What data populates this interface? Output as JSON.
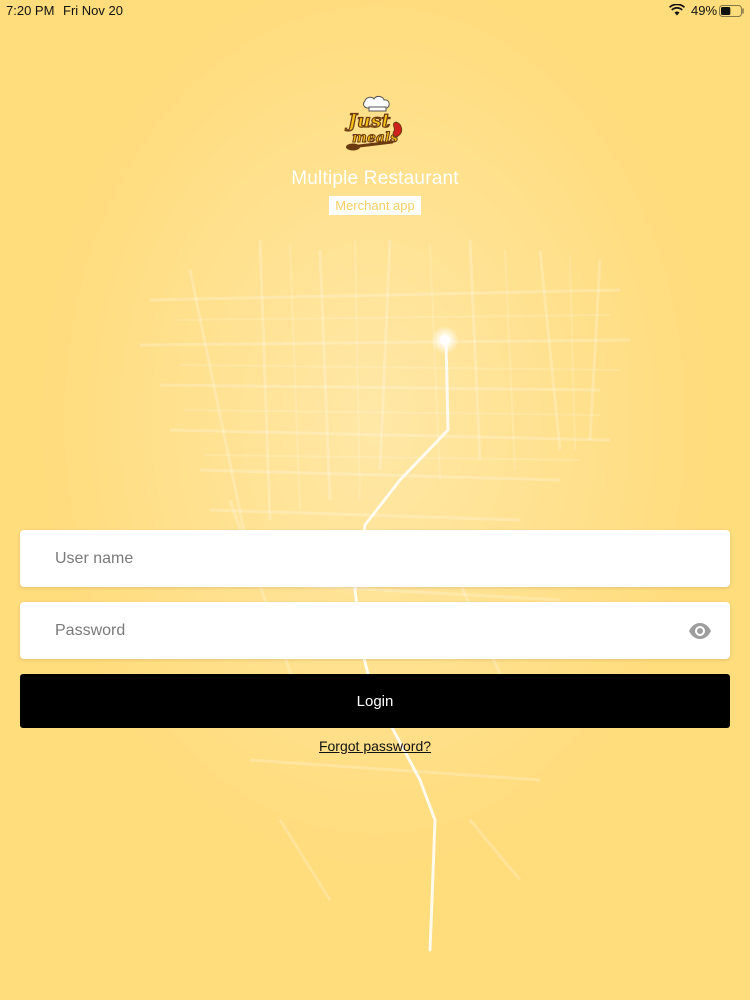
{
  "status_bar": {
    "time": "7:20 PM",
    "date": "Fri Nov 20",
    "battery_percent": "49%",
    "battery_level": 0.49,
    "wifi_icon": "wifi-icon",
    "battery_icon": "battery-icon"
  },
  "branding": {
    "logo_line1": "Just",
    "logo_line2": "meals",
    "title": "Multiple Restaurant",
    "badge": "Merchant app"
  },
  "form": {
    "username_placeholder": "User name",
    "username_value": "",
    "password_placeholder": "Password",
    "password_value": "",
    "password_toggle_icon": "eye-icon",
    "login_label": "Login",
    "forgot_label": "Forgot password?"
  },
  "colors": {
    "background": "#ffdc7c",
    "button": "#000000",
    "button_text": "#ffffff",
    "badge_text": "#f7cf63",
    "logo_brown": "#6b3a10",
    "logo_yellow": "#f6c318",
    "logo_red": "#d0201d"
  }
}
